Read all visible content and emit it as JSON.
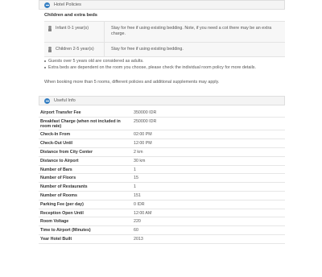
{
  "hotel_policies": {
    "title": "Hotel Policies",
    "subtitle": "Children and extra beds",
    "children": [
      {
        "age": "Infant 0-1 year(s)",
        "policy": "Stay for free if using existing bedding. Note, if you need a cot there may be an extra charge."
      },
      {
        "age": "Children 2-5 year(s)",
        "policy": "Stay for free if using existing bedding."
      }
    ],
    "notes": [
      "Guests over 5 years old are considered as adults.",
      "Extra beds are dependent on the room you choose, please check the individual room policy for more details."
    ],
    "booking_note": "When booking more than 5 rooms, different policies and additional supplements may apply."
  },
  "useful_info": {
    "title": "Useful Info",
    "rows": [
      {
        "label": "Airport Transfer Fee",
        "value": "350000 IDR"
      },
      {
        "label": "Breakfast Charge (when not included in room rate)",
        "value": "250000 IDR"
      },
      {
        "label": "Check-In From",
        "value": "02:00 PM"
      },
      {
        "label": "Check-Out Until",
        "value": "12:00 PM"
      },
      {
        "label": "Distance from City Center",
        "value": "2 km"
      },
      {
        "label": "Distance to Airport",
        "value": "30 km"
      },
      {
        "label": "Number of Bars",
        "value": "1"
      },
      {
        "label": "Number of Floors",
        "value": "15"
      },
      {
        "label": "Number of Restaurants",
        "value": "1"
      },
      {
        "label": "Number of Rooms",
        "value": "151"
      },
      {
        "label": "Parking Fee (per day)",
        "value": "0 IDR"
      },
      {
        "label": "Reception Open Until",
        "value": "12:00 AM"
      },
      {
        "label": "Room Voltage",
        "value": "220"
      },
      {
        "label": "Time to Airport (Minutes)",
        "value": "60"
      },
      {
        "label": "Year Hotel Built",
        "value": "2013"
      }
    ]
  }
}
